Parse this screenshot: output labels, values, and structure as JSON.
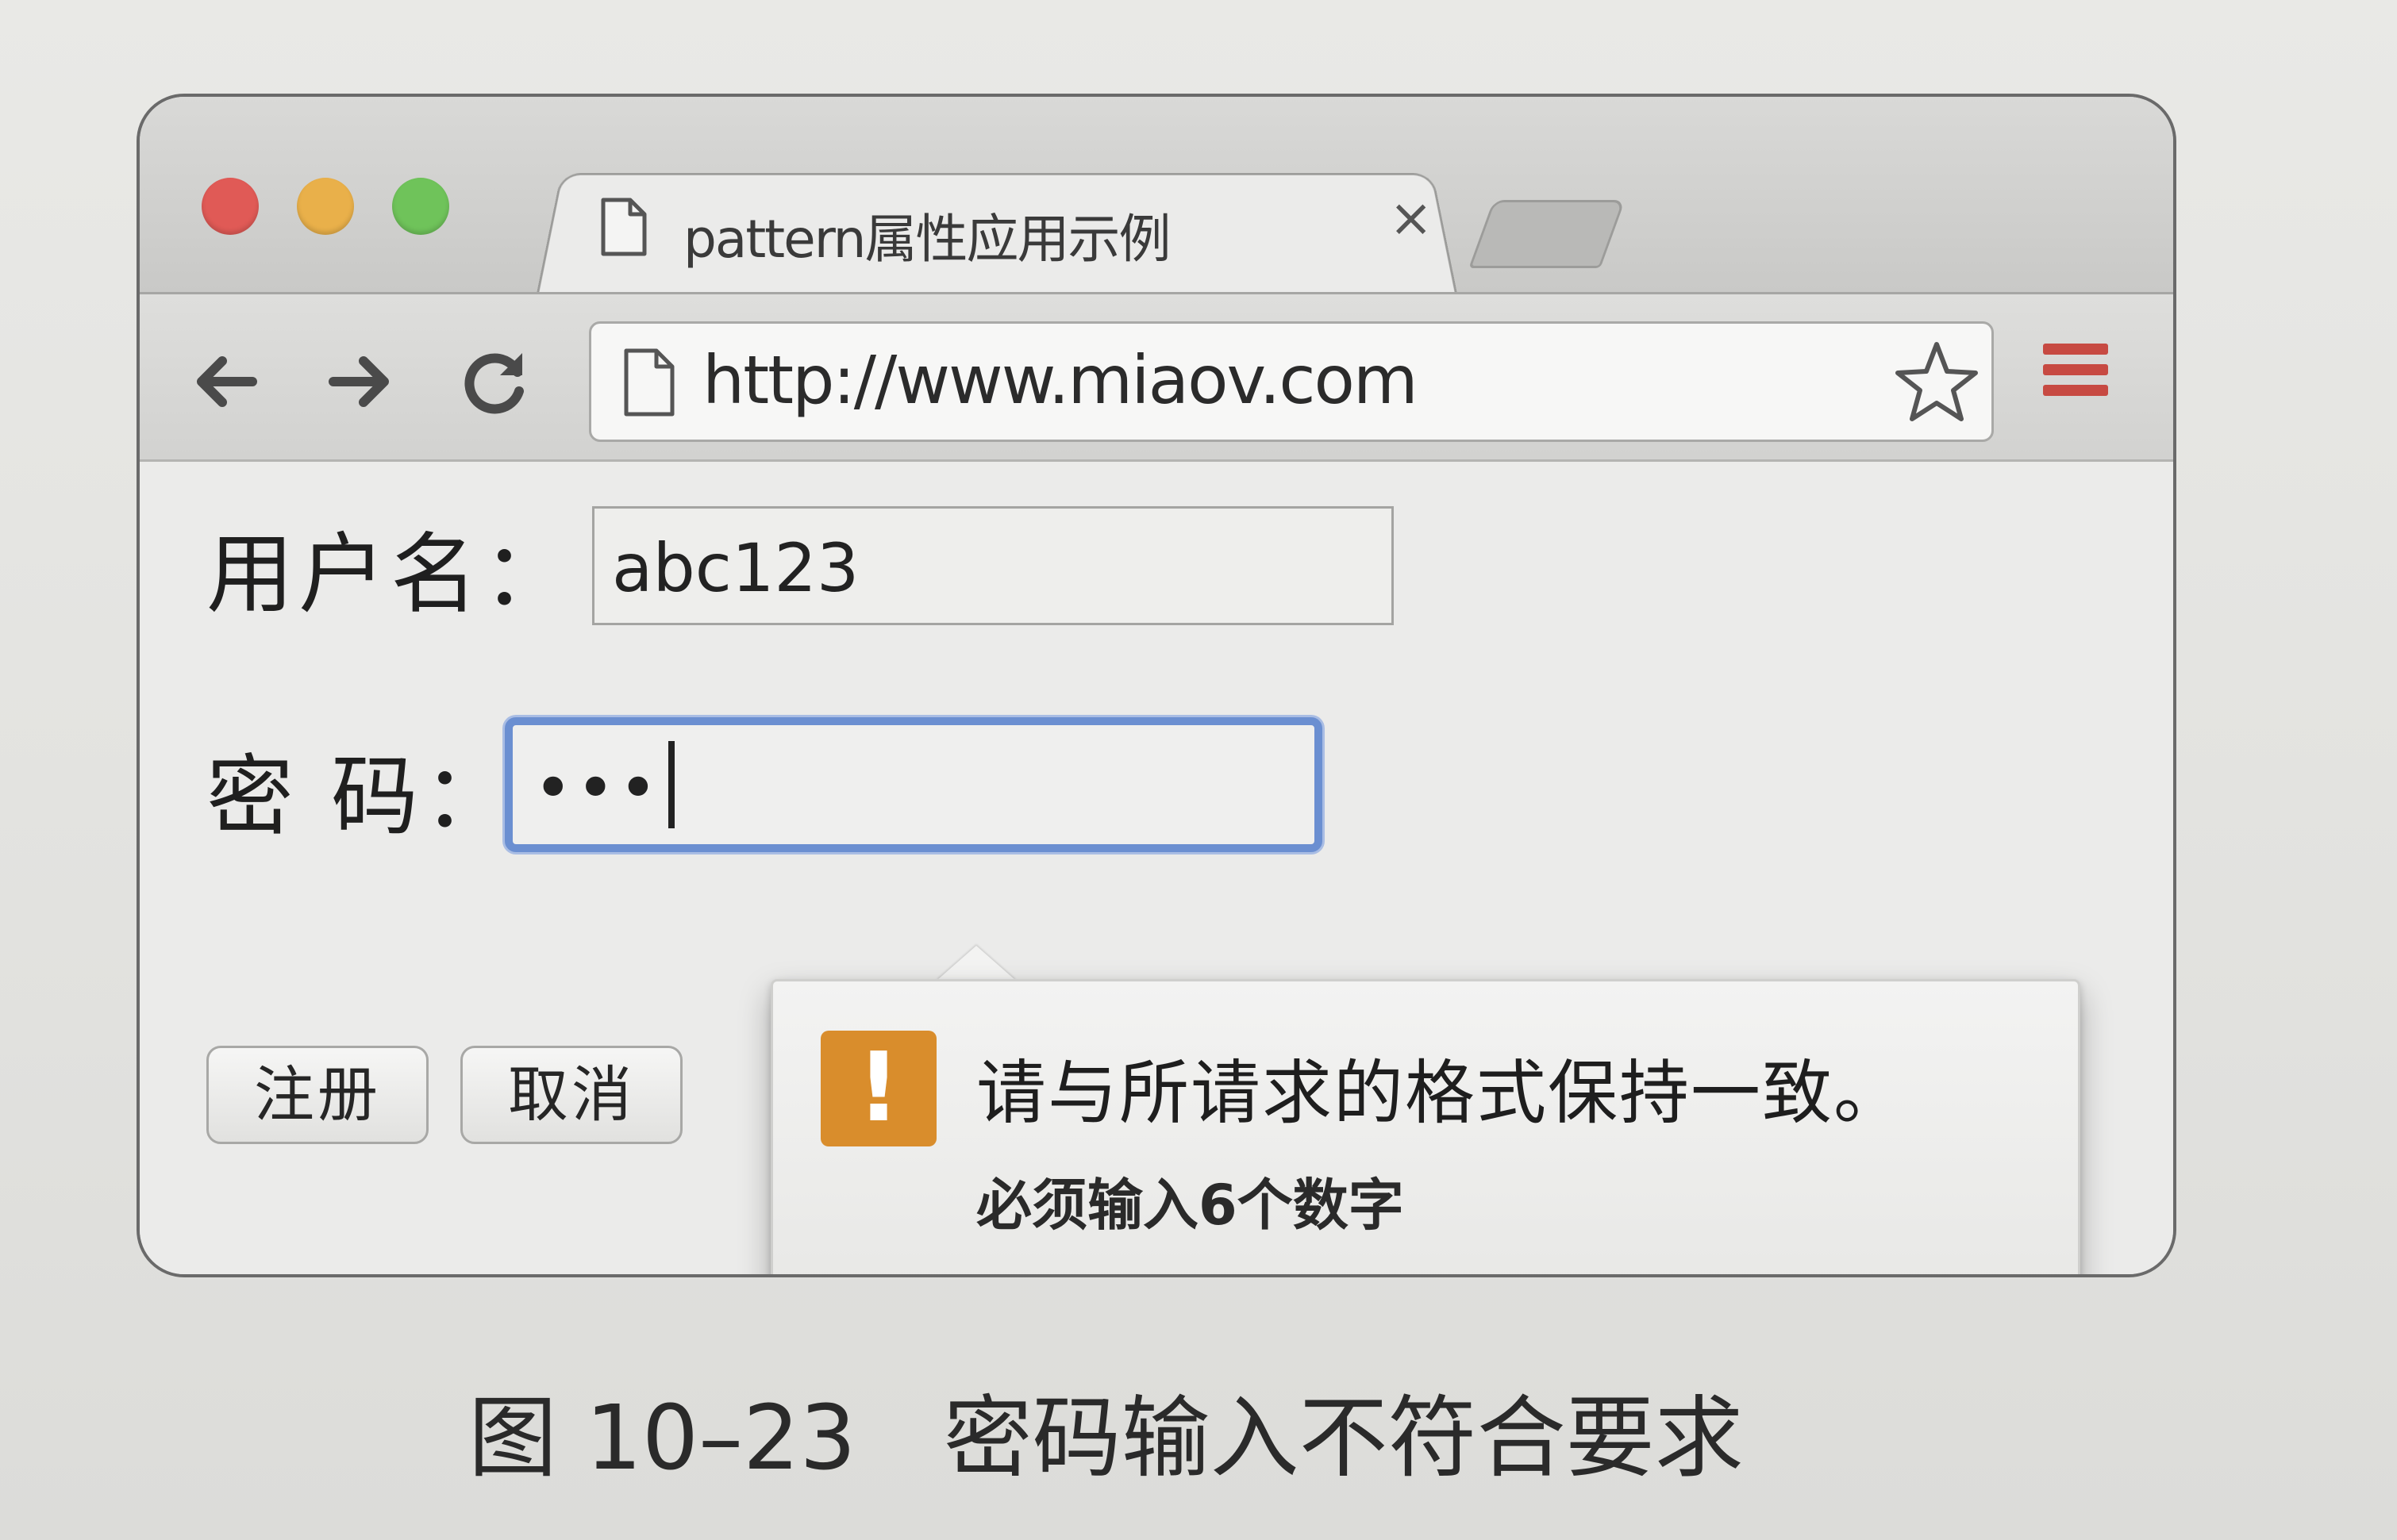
{
  "browser": {
    "tab": {
      "title": "pattern属性应用示例",
      "close_glyph": "×"
    },
    "address_bar": {
      "url": "http://www.miaov.com"
    },
    "window_controls": {
      "close_color": "#e05a56",
      "minimize_color": "#e9b04a",
      "zoom_color": "#6fc35a"
    },
    "menu_color": "#c74a42"
  },
  "form": {
    "username": {
      "label": "用户名：",
      "value": "abc123"
    },
    "password": {
      "label": "密 码：",
      "value": "•••"
    },
    "buttons": {
      "register_label": "注册",
      "cancel_label": "取消"
    }
  },
  "validation": {
    "icon": "exclamation-icon",
    "icon_glyph": "!",
    "message": "请与所请求的格式保持一致。",
    "hint": "必须输入6个数字",
    "icon_color": "#d98d2c",
    "focus_color": "#6b8fd1"
  },
  "caption": {
    "figure_number": "图 10–23",
    "text": "密码输入不符合要求"
  }
}
